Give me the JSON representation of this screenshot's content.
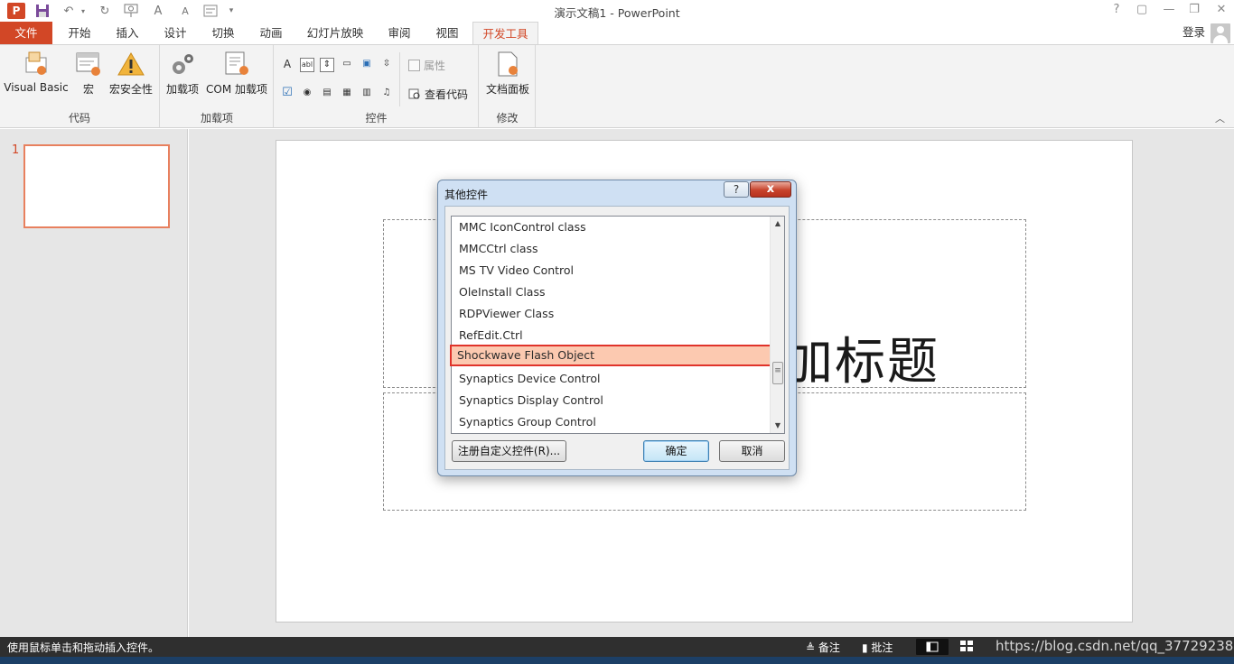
{
  "window": {
    "title": "演示文稿1 - PowerPoint",
    "app_icon_letter": "P",
    "controls": [
      "?",
      "▢",
      "—",
      "❐",
      "✕"
    ]
  },
  "quick_access": {
    "font_grow": "A",
    "font_shrink": "A"
  },
  "tabs": [
    {
      "label": "文件"
    },
    {
      "label": "开始"
    },
    {
      "label": "插入"
    },
    {
      "label": "设计"
    },
    {
      "label": "切换"
    },
    {
      "label": "动画"
    },
    {
      "label": "幻灯片放映"
    },
    {
      "label": "审阅"
    },
    {
      "label": "视图"
    },
    {
      "label": "开发工具"
    }
  ],
  "account": {
    "login": "登录"
  },
  "ribbon": {
    "groups": {
      "code": "代码",
      "addins": "加载项",
      "controls": "控件",
      "modify": "修改"
    },
    "buttons": {
      "visual_basic": "Visual Basic",
      "macro": "宏",
      "macro_security": "宏安全性",
      "addins": "加载项",
      "com_addins": "COM 加载项",
      "properties": "属性",
      "view_code": "查看代码",
      "document_panel": "文档面板"
    },
    "small_controls_row1": [
      "A",
      "abl",
      "⇕",
      "▭",
      "▣",
      "⇳"
    ],
    "small_controls_row2": [
      "☑",
      "◉",
      "▤",
      "▦",
      "▥",
      "♫"
    ]
  },
  "thumbnails": {
    "slide_number": "1"
  },
  "slide": {
    "title_fragment": "加标题"
  },
  "dialog": {
    "title": "其他控件",
    "help": "?",
    "close": "x",
    "items": [
      "MMC IconControl class",
      "MMCCtrl class",
      "MS TV Video Control",
      "OleInstall Class",
      "RDPViewer Class",
      "RefEdit.Ctrl",
      "Shockwave Flash Object",
      "Synaptics Device Control",
      "Synaptics Display Control",
      "Synaptics Group Control"
    ],
    "selected_item": "Shockwave Flash Object",
    "register_button": "注册自定义控件(R)...",
    "ok_button": "确定",
    "cancel_button": "取消"
  },
  "statusbar": {
    "message": "使用鼠标单击和拖动插入控件。",
    "notes": "≜ 备注",
    "comments": "▮ 批注",
    "watermark": "https://blog.csdn.net/qq_37729238"
  },
  "colors": {
    "accent": "#d24726",
    "selection_fill": "#fcc9b0",
    "selection_border": "#e0332a"
  }
}
